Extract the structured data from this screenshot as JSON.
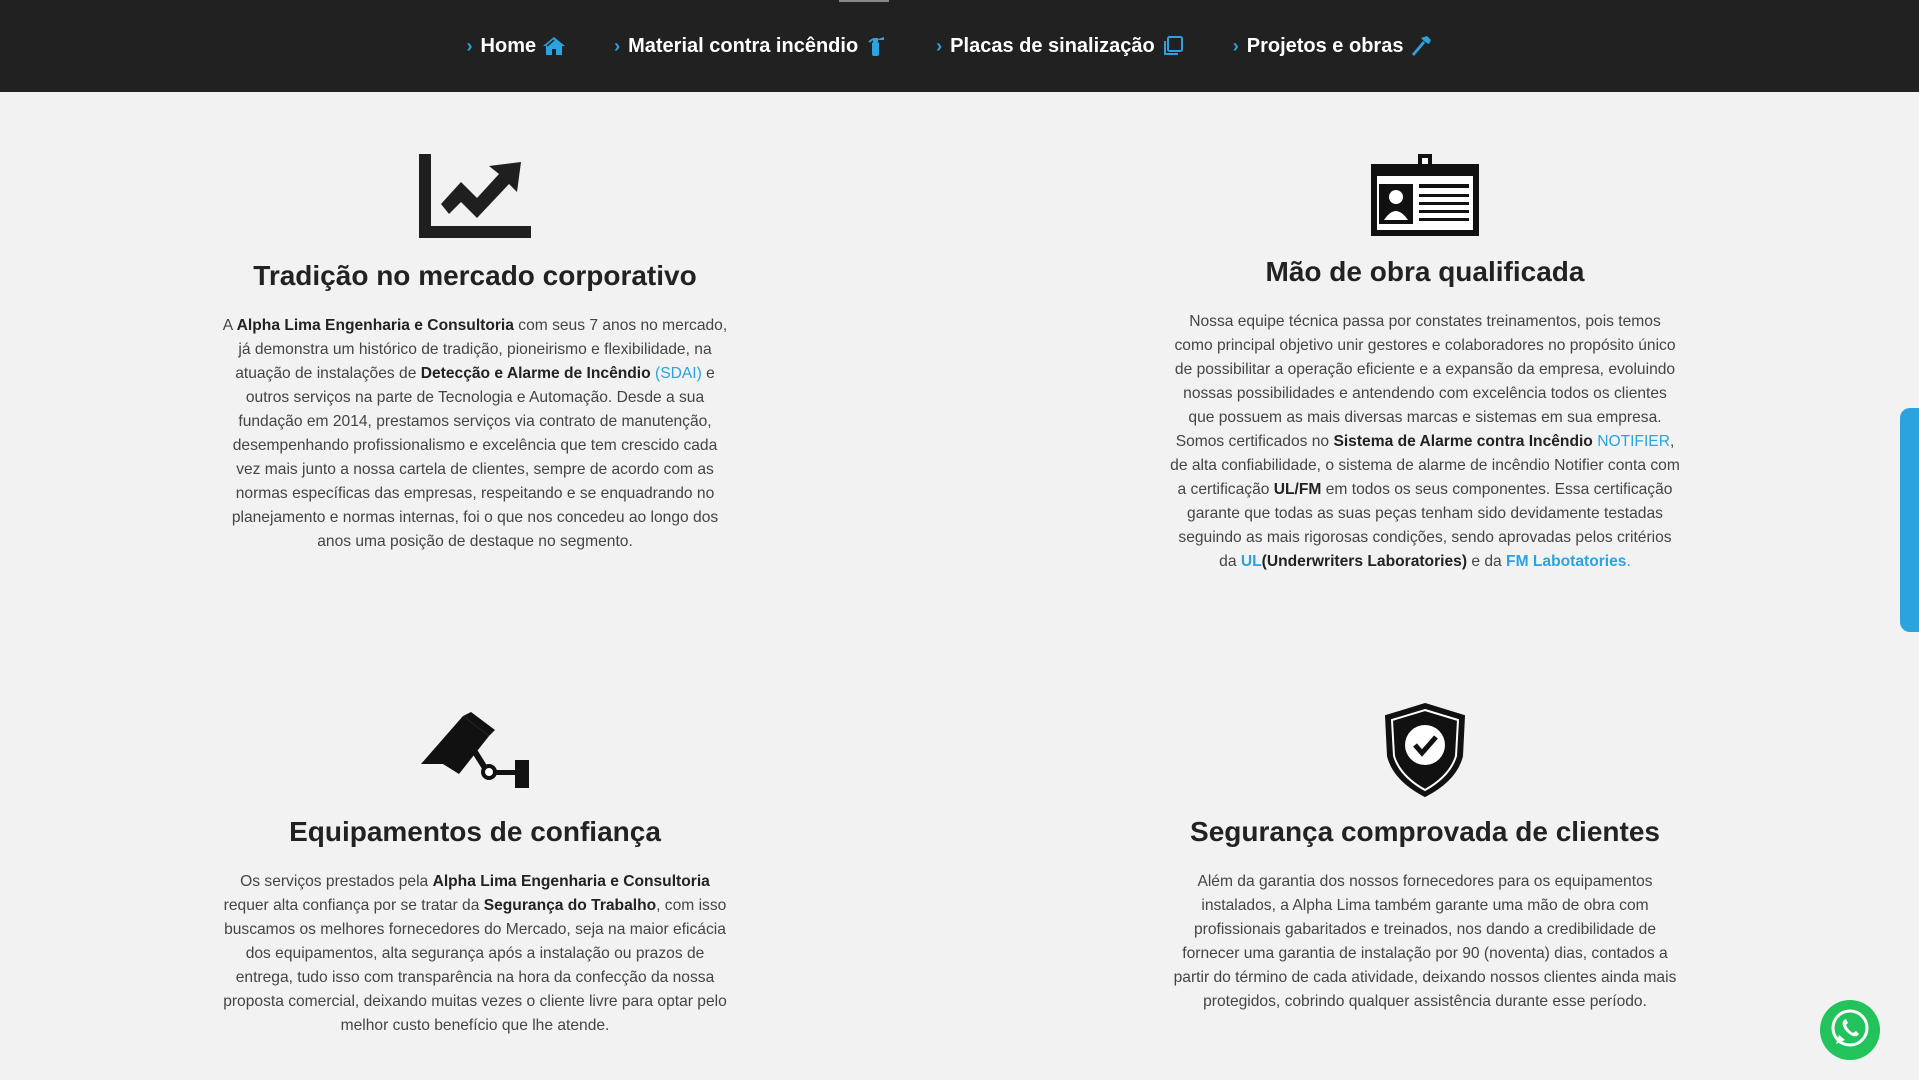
{
  "nav": {
    "items": [
      {
        "label": "Home",
        "icon": "home-icon"
      },
      {
        "label": "Material contra incêndio",
        "icon": "fire-extinguisher-icon"
      },
      {
        "label": "Placas de sinalização",
        "icon": "copy-icon"
      },
      {
        "label": "Projetos e obras",
        "icon": "hammer-icon"
      }
    ]
  },
  "features": {
    "f1": {
      "title": "Tradição no mercado corporativo",
      "icon": "chart-line-icon",
      "p": {
        "a1": "A ",
        "b1": "Alpha Lima Engenharia e Consultoria",
        "a2": " com seus 7 anos no mercado, já demonstra um histórico de tradição, pioneirismo e flexibilidade, na atuação de instalações de ",
        "b2": "Detecção e Alarme de Incêndio",
        "a3": " ",
        "l1": "(SDAI)",
        "a4": " e outros serviços na parte de Tecnologia e Automação. Desde a sua fundação em 2014, prestamos serviços via contrato de manutenção, desempenhando profissionalismo e excelência que tem crescido cada vez mais junto a nossa cartela de clientes, sempre de acordo com as normas específicas das empresas, respeitando e se enquadrando no planejamento e normas internas, foi o que nos concedeu ao longo dos anos uma posição de destaque no segmento."
      }
    },
    "f2": {
      "title": "Mão de obra qualificada",
      "icon": "id-card-icon",
      "p": {
        "a1": "Nossa equipe técnica passa por constates treinamentos, pois temos como principal objetivo unir gestores e colaboradores no propósito único de possibilitar a operação eficiente e a expansão da empresa, evoluindo nossas possibilidades e antendendo com excelência todos os clientes que possuem as mais diversas marcas e sistemas em sua empresa. Somos certificados no ",
        "b1": "Sistema de Alarme contra Incêndio",
        "a2": " ",
        "l1": "NOTIFIER",
        "a3": ", de alta confiabilidade, o sistema de alarme de incêndio Notifier conta com a certificação ",
        "b2": "UL/FM",
        "a4": " em todos os seus componentes. Essa certificação garante que todas as suas peças tenham sido devidamente testadas seguindo as mais rigorosas condições, sendo aprovadas pelos critérios da ",
        "l2": "UL",
        "b3": "(Underwriters Laboratories)",
        "a5": " e da ",
        "l3": "FM Labotatories",
        "a6": "."
      }
    },
    "f3": {
      "title": "Equipamentos de confiança",
      "icon": "security-camera-icon",
      "p": {
        "a1": "Os serviços prestados pela ",
        "b1": "Alpha Lima Engenharia e Consultoria",
        "a2": " requer alta confiança por se tratar da ",
        "b2": "Segurança do Trabalho",
        "a3": ", com isso buscamos os melhores fornecedores do Mercado, seja na maior eficácia dos equipamentos, alta segurança após a instalação ou prazos de entrega, tudo isso com transparência na hora da confecção da nossa proposta comercial, deixando muitas vezes o cliente livre para optar pelo melhor custo benefício que lhe atende."
      }
    },
    "f4": {
      "title": "Segurança comprovada de clientes",
      "icon": "shield-check-icon",
      "p": {
        "a1": "Além da garantia dos nossos fornecedores para os equipamentos instalados, a Alpha Lima também garante uma mão de obra com profissionais gabaritados e treinados, nos dando a credibilidade de fornecer uma garantia de instalação por 90 (noventa) dias, contados a partir do término de cada atividade, deixando nossos clientes ainda mais protegidos, cobrindo qualquer assistência durante esse período."
      }
    }
  },
  "colors": {
    "accent": "#2aa3df",
    "header_bg": "#212121",
    "page_bg": "#f2f2f2",
    "whatsapp": "#21c35a"
  },
  "widgets": {
    "whatsapp_icon": "whatsapp-icon"
  }
}
